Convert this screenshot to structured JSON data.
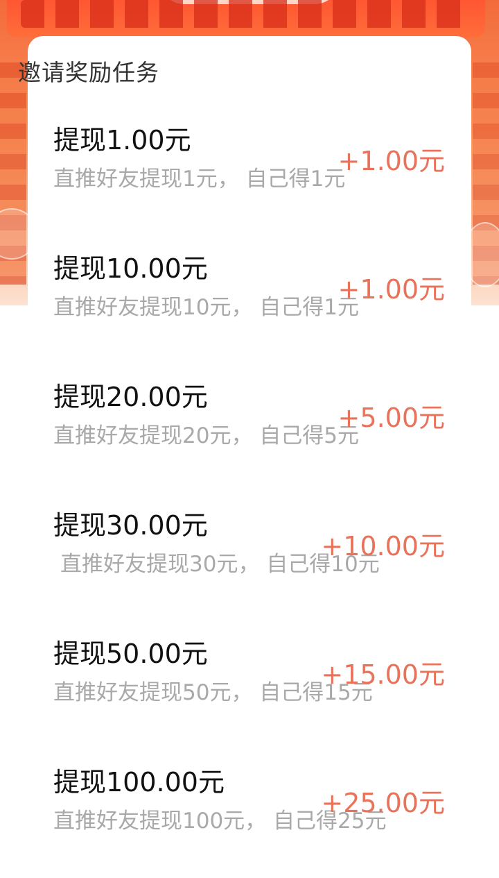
{
  "section_title": "邀请奖励任务",
  "tasks": [
    {
      "title": "提现1.00元",
      "desc": "直推好友提现1元， 自己得1元",
      "reward": "+1.00元"
    },
    {
      "title": "提现10.00元",
      "desc": "直推好友提现10元， 自己得1元",
      "reward": "+1.00元"
    },
    {
      "title": "提现20.00元",
      "desc": "直推好友提现20元， 自己得5元",
      "reward": "+5.00元"
    },
    {
      "title": "提现30.00元",
      "desc": "直推好友提现30元， 自己得10元",
      "reward": "+10.00元"
    },
    {
      "title": "提现50.00元",
      "desc": "直推好友提现50元， 自己得15元",
      "reward": "+15.00元"
    },
    {
      "title": "提现100.00元",
      "desc": "直推好友提现100元， 自己得25元",
      "reward": "+25.00元"
    }
  ],
  "colors": {
    "banner": "#f36a3a",
    "reward": "#e8725a",
    "title_text": "#111111",
    "desc_text": "#a9a9a9"
  }
}
